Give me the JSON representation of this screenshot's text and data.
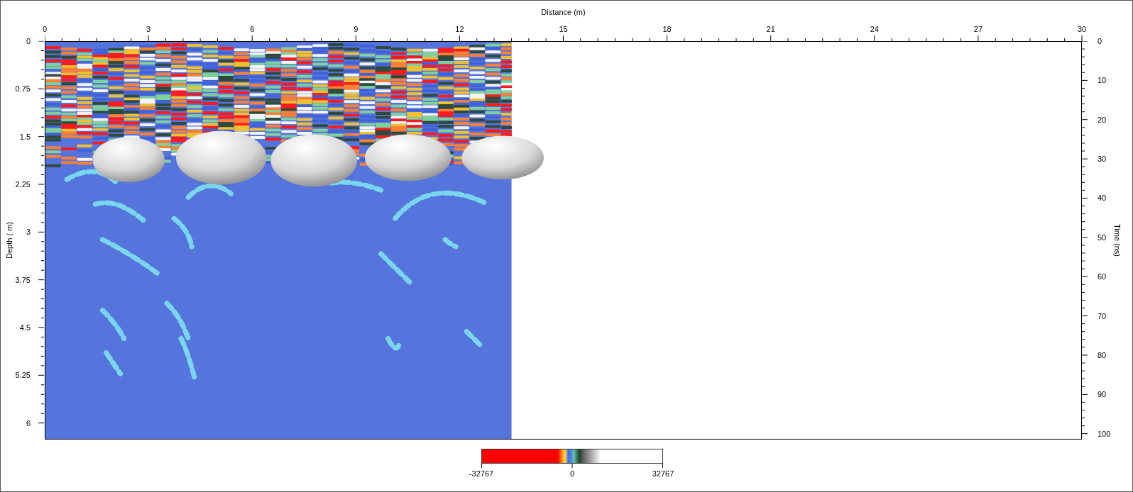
{
  "plot": {
    "x_axis": {
      "title": "Distance (m)",
      "ticks": [
        "0",
        "3",
        "6",
        "9",
        "12",
        "15",
        "18",
        "21",
        "24",
        "27",
        "30"
      ]
    },
    "left_axis": {
      "title": "Depth ( m)",
      "ticks": [
        "0",
        "0.75",
        "1.5",
        "2.25",
        "3",
        "3.75",
        "4.5",
        "5.25",
        "6"
      ]
    },
    "right_axis": {
      "title": "Time (ns)",
      "ticks": [
        "0",
        "10",
        "20",
        "30",
        "40",
        "50",
        "60",
        "70",
        "80",
        "90",
        "100"
      ]
    }
  },
  "colorbar": {
    "min_label": "-32767",
    "mid_label": "0",
    "max_label": "32767"
  }
}
